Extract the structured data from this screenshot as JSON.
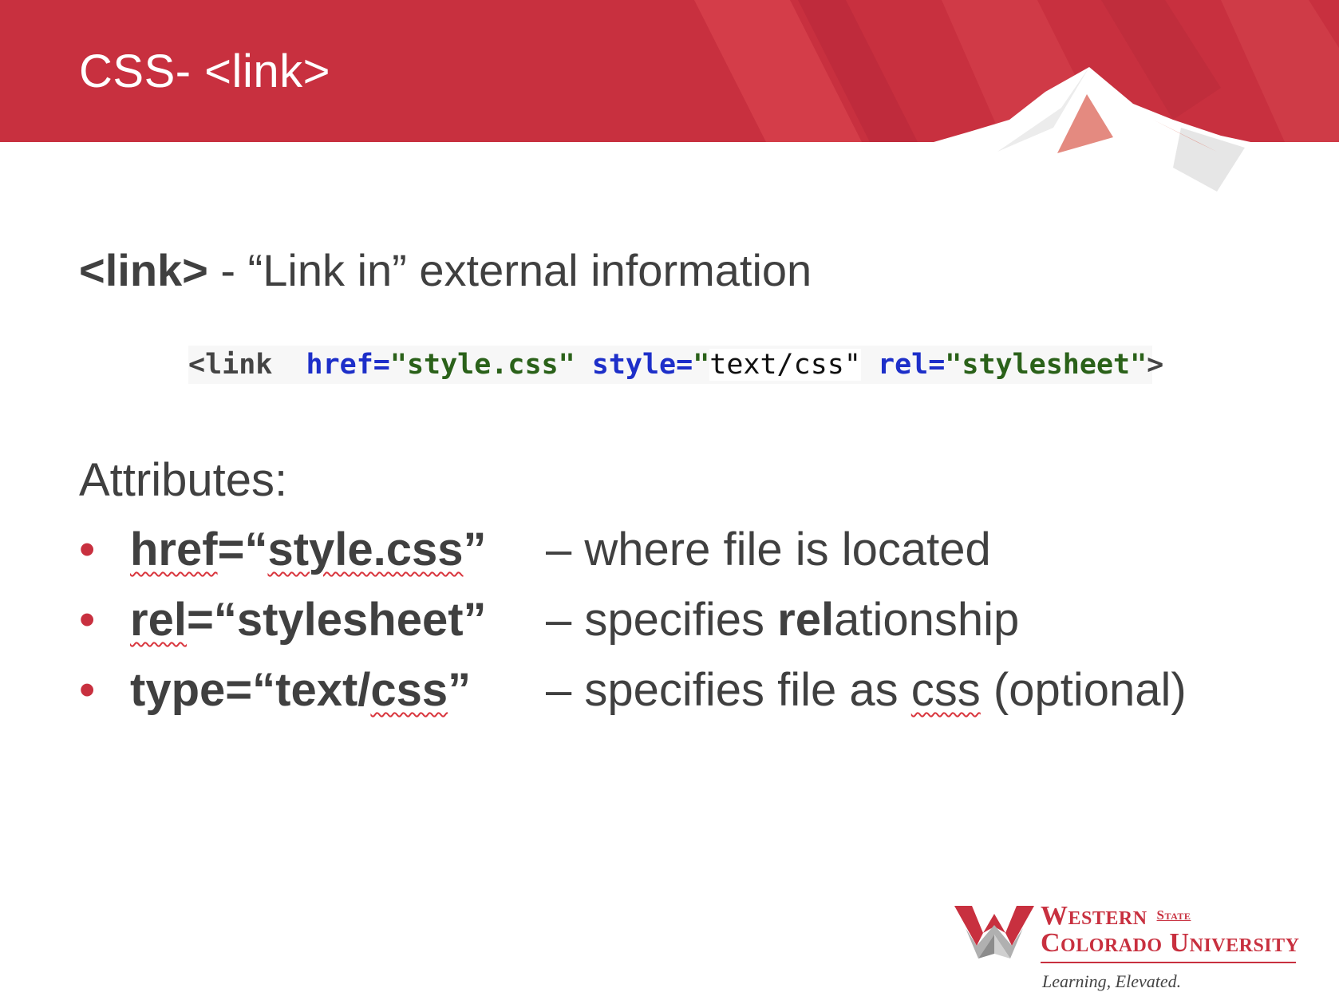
{
  "slide": {
    "title": "CSS- <link>",
    "subtitle_tag": "<link>",
    "subtitle_rest": " - “Link in” external information"
  },
  "code_snippet": {
    "open": "<link",
    "href_attr": "href=",
    "href_value": "\"style.css\"",
    "style_attr": "style=",
    "style_value_open": "\"",
    "style_value_text": "text/css\"",
    "rel_attr": "rel=",
    "rel_value": "\"stylesheet\"",
    "close": ">"
  },
  "attributes": {
    "heading": "Attributes:",
    "items": [
      {
        "bullet": "•",
        "name_prefix": "href",
        "name_mid": "=“",
        "name_squiggle": "style.css",
        "name_suffix": "”",
        "description_pre": "– where file is located",
        "description_bold": "",
        "description_post": ""
      },
      {
        "bullet": "•",
        "name_prefix": "rel",
        "name_mid": "=“stylesheet”",
        "name_squiggle": "",
        "name_suffix": "",
        "description_pre": "– specifies ",
        "description_bold": "rel",
        "description_post": "ationship"
      },
      {
        "bullet": "•",
        "name_prefix": "type=“text/",
        "name_mid": "",
        "name_squiggle": "css",
        "name_suffix": "”",
        "description_pre": "– specifies file as ",
        "description_squiggle": "css",
        "description_post": " (optional)"
      }
    ]
  },
  "logo": {
    "line1": "Western",
    "line1_small": "State",
    "line2": "Colorado University",
    "tagline": "Learning, Elevated."
  },
  "colors": {
    "banner_red": "#c8303f",
    "text_gray": "#404040",
    "accent_red": "#c8303f"
  }
}
